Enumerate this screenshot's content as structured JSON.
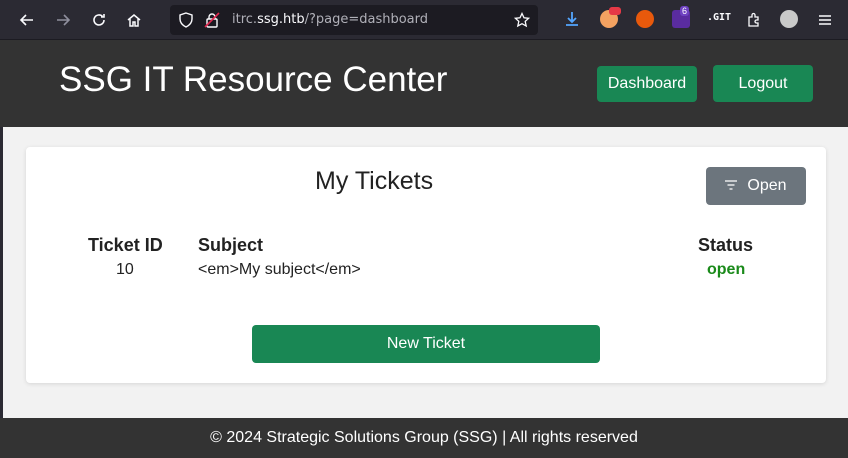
{
  "browser": {
    "url_prefix": "itrc.",
    "url_host": "ssg.htb",
    "url_path": "/?page=dashboard",
    "tab_count_badge": "6"
  },
  "header": {
    "title": "SSG IT Resource Center",
    "dashboard_label": "Dashboard",
    "logout_label": "Logout"
  },
  "tickets": {
    "title": "My Tickets",
    "filter_label": "Open",
    "columns": {
      "id": "Ticket ID",
      "subject": "Subject",
      "status": "Status"
    },
    "rows": [
      {
        "id": "10",
        "subject": "<em>My subject</em>",
        "status": "open"
      }
    ],
    "new_ticket_label": "New Ticket"
  },
  "footer": {
    "text": "© 2024 Strategic Solutions Group (SSG) | All rights reserved"
  },
  "colors": {
    "accent_green": "#198754",
    "header_bg": "#333333",
    "filter_gray": "#6c757d",
    "status_open": "#1a8a1a"
  }
}
